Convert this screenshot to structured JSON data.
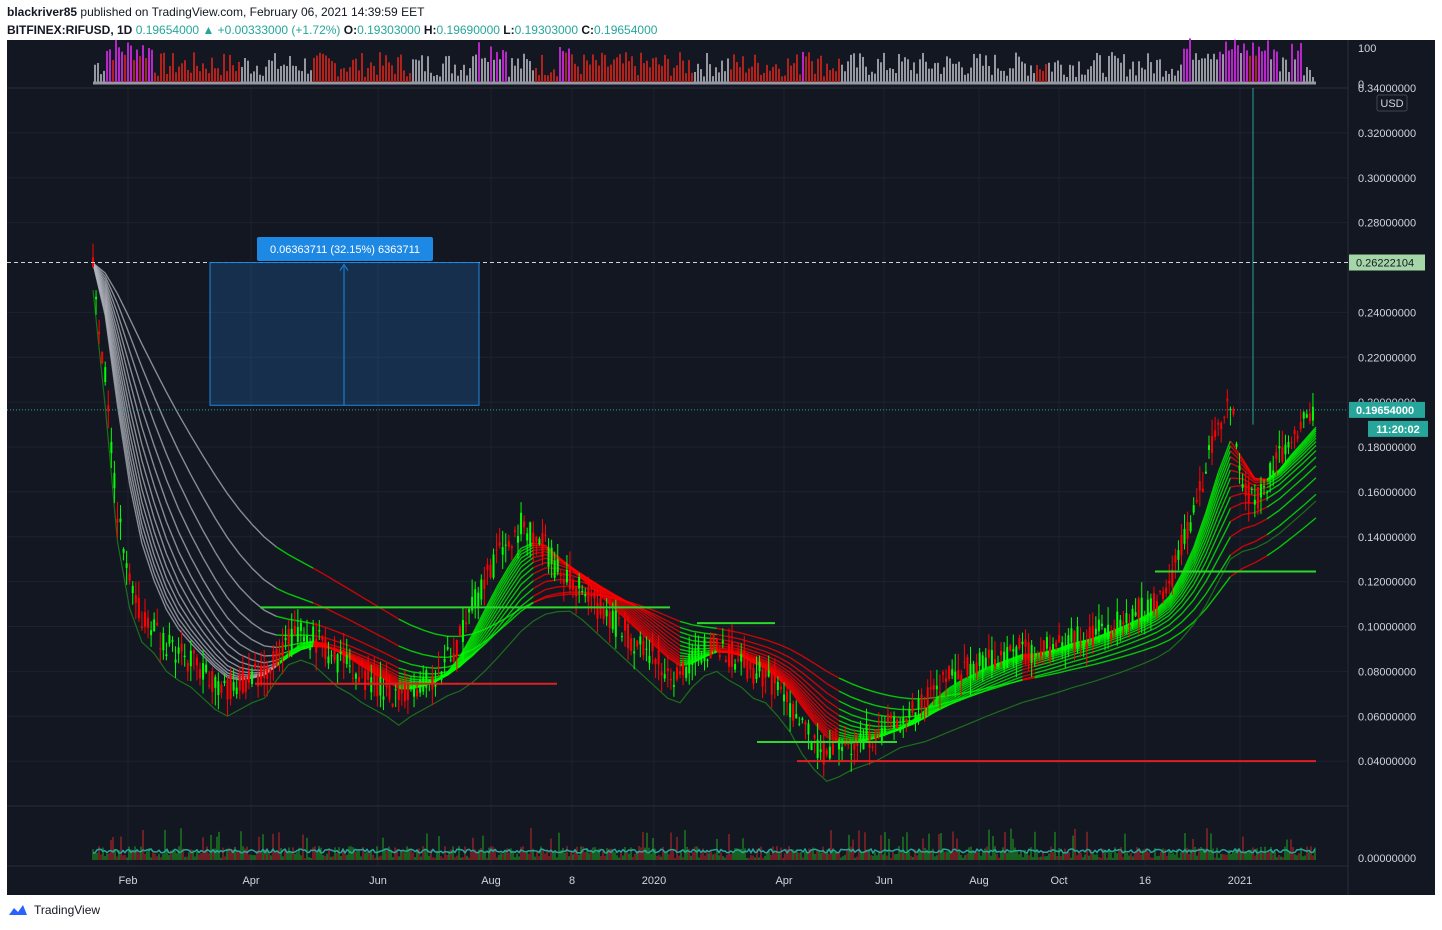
{
  "header": {
    "line1_user": "blackriver85",
    "line1_rest": "published on TradingView.com, February 06, 2021 14:39:59 EET",
    "symbol": "BITFINEX:RIFUSD, 1D",
    "last": "0.19654000",
    "change": "▲ +0.00333000 (+1.72%)",
    "o_label": "O:",
    "o": "0.19303000",
    "h_label": "H:",
    "h": "0.19690000",
    "l_label": "L:",
    "l": "0.19303000",
    "c_label": "C:",
    "c": "0.19654000"
  },
  "footer": {
    "brand": "TradingView"
  },
  "colors": {
    "background": "#131722",
    "grid": "#1e222d",
    "bull": "#00ff00",
    "bear": "#ff0000",
    "accent": "#26a69a",
    "measure": "#1e88e5"
  },
  "chart_data": {
    "type": "line",
    "symbol": "BITFINEX:RIFUSD",
    "timeframe": "1D",
    "currency_badge": "USD",
    "ylim": [
      0.02,
      0.34
    ],
    "y_ticks": [
      "0.34000000",
      "0.32000000",
      "0.30000000",
      "0.28000000",
      "0.24000000",
      "0.22000000",
      "0.20000000",
      "0.18000000",
      "0.16000000",
      "0.14000000",
      "0.12000000",
      "0.10000000",
      "0.08000000",
      "0.06000000",
      "0.04000000"
    ],
    "x_ticks": [
      "Feb",
      "Apr",
      "Jun",
      "Aug",
      "8",
      "2020",
      "Apr",
      "Jun",
      "Aug",
      "Oct",
      "16",
      "2021"
    ],
    "oscillator_ticks": [
      "100",
      "0"
    ],
    "volume_tick": "0.00000000",
    "price_marker": "0.19654000",
    "countdown": "11:20:02",
    "hline_marker": "0.26222104",
    "measure_label": "0.06363711 (32.15%) 6363711",
    "measure_range": [
      0.1986,
      0.2622
    ],
    "series": [
      {
        "values": [
          0.262,
          0.21,
          0.15,
          0.12,
          0.105,
          0.1,
          0.092,
          0.088,
          0.085,
          0.08,
          0.075,
          0.072,
          0.075,
          0.078,
          0.08,
          0.088,
          0.095,
          0.097,
          0.095,
          0.09,
          0.085,
          0.082,
          0.078,
          0.075,
          0.072,
          0.068,
          0.072,
          0.075,
          0.078,
          0.085,
          0.095,
          0.108,
          0.12,
          0.13,
          0.138,
          0.145,
          0.14,
          0.135,
          0.125,
          0.12,
          0.115,
          0.11,
          0.105,
          0.1,
          0.095,
          0.09,
          0.085,
          0.08,
          0.078,
          0.085,
          0.09,
          0.092,
          0.088,
          0.085,
          0.08,
          0.078,
          0.072,
          0.065,
          0.055,
          0.048,
          0.043,
          0.045,
          0.048,
          0.05,
          0.052,
          0.055,
          0.058,
          0.062,
          0.068,
          0.075,
          0.078,
          0.08,
          0.082,
          0.085,
          0.086,
          0.088,
          0.09,
          0.088,
          0.09,
          0.092,
          0.095,
          0.095,
          0.097,
          0.1,
          0.102,
          0.105,
          0.108,
          0.112,
          0.12,
          0.135,
          0.15,
          0.17,
          0.19,
          0.2,
          0.165,
          0.155,
          0.165,
          0.175,
          0.185,
          0.19,
          0.1965
        ]
      }
    ],
    "levels": [
      0.1085,
      0.1015,
      0.0745,
      0.0485,
      0.04,
      0.1245
    ]
  }
}
